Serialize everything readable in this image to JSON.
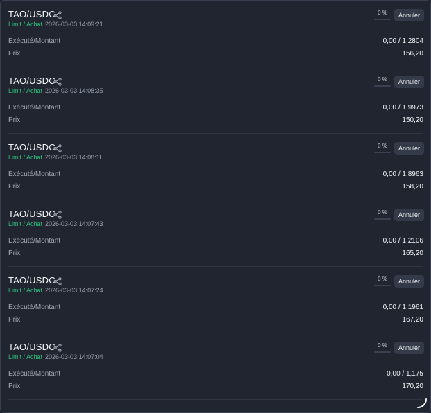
{
  "orders": [
    {
      "pair": "TAO/USDC",
      "type": "Limit / Achat",
      "time": "2026-03-03 14:09:21",
      "percent": "0 %",
      "cancel": "Annuler",
      "exec_label": "Exécuté/Montant",
      "exec_value": "0,00 / 1,2804",
      "price_label": "Prix",
      "price_value": "156,20"
    },
    {
      "pair": "TAO/USDC",
      "type": "Limit / Achat",
      "time": "2026-03-03 14:08:35",
      "percent": "0 %",
      "cancel": "Annuler",
      "exec_label": "Exécuté/Montant",
      "exec_value": "0,00 / 1,9973",
      "price_label": "Prix",
      "price_value": "150,20"
    },
    {
      "pair": "TAO/USDC",
      "type": "Limit / Achat",
      "time": "2026-03-03 14:08:11",
      "percent": "0 %",
      "cancel": "Annuler",
      "exec_label": "Exécuté/Montant",
      "exec_value": "0,00 / 1,8963",
      "price_label": "Prix",
      "price_value": "158,20"
    },
    {
      "pair": "TAO/USDC",
      "type": "Limit / Achat",
      "time": "2026-03-03 14:07:43",
      "percent": "0 %",
      "cancel": "Annuler",
      "exec_label": "Exécuté/Montant",
      "exec_value": "0,00 / 1,2106",
      "price_label": "Prix",
      "price_value": "165,20"
    },
    {
      "pair": "TAO/USDC",
      "type": "Limit / Achat",
      "time": "2026-03-03 14:07:24",
      "percent": "0 %",
      "cancel": "Annuler",
      "exec_label": "Exécuté/Montant",
      "exec_value": "0,00 / 1,1961",
      "price_label": "Prix",
      "price_value": "167,20"
    },
    {
      "pair": "TAO/USDC",
      "type": "Limit / Achat",
      "time": "2026-03-03 14:07:04",
      "percent": "0 %",
      "cancel": "Annuler",
      "exec_label": "Exécuté/Montant",
      "exec_value": "0,00 / 1,175",
      "price_label": "Prix",
      "price_value": "170,20"
    }
  ],
  "colors": {
    "background": "#202530",
    "accent_green": "#2fbf7e",
    "button_bg": "#343a47"
  },
  "icons": {
    "share": "share-icon",
    "spinner": "loading-spinner-icon"
  }
}
